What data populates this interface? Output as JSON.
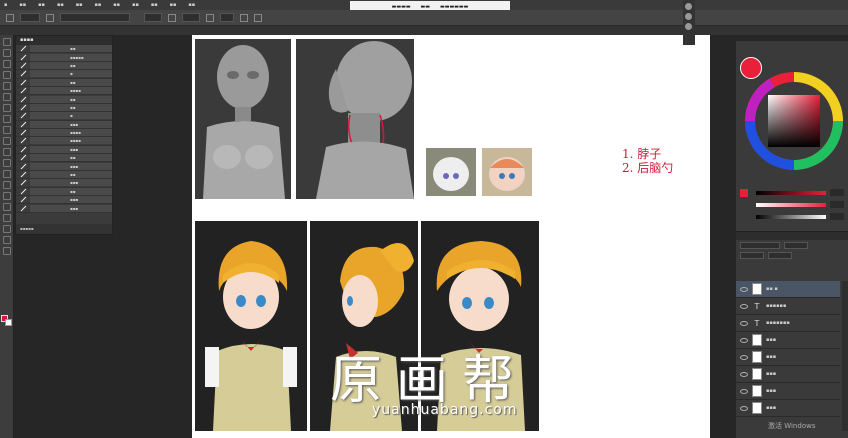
{
  "window": {
    "title_hint": "原画帮",
    "watermark_url": "yuanhuabang.com"
  },
  "canvas_notes": [
    "1. 脖子",
    "2. 后脑勺"
  ],
  "watermark": {
    "text": "原画帮",
    "url": "yuanhuabang.com"
  },
  "activate_text": "激活 Windows",
  "colors": {
    "foreground": "#d1193a",
    "background": "#ffffff",
    "accent_red": "#d1193a"
  }
}
